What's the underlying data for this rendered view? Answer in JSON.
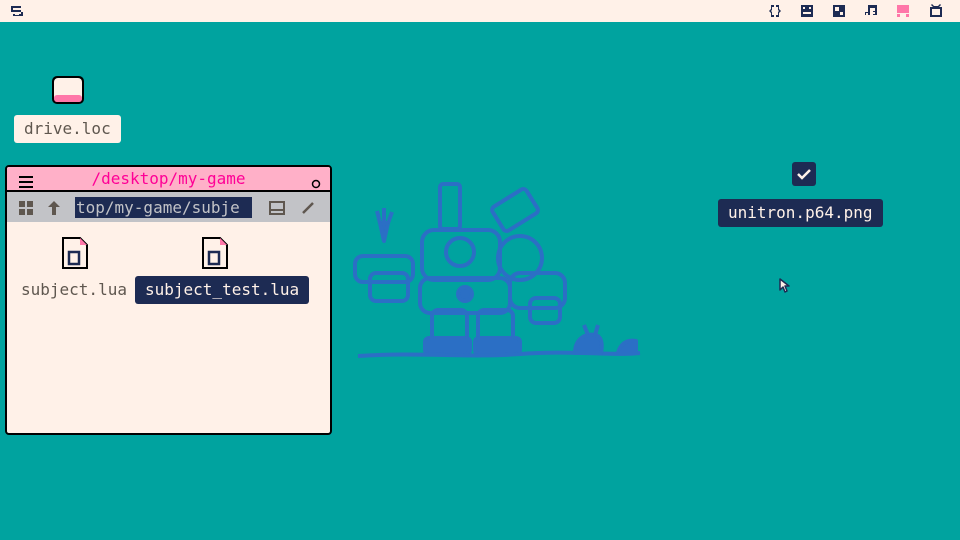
{
  "topbar": {
    "left_icon": "picotron-logo-icon",
    "right_icons": [
      "code-editor-icon",
      "sprite-editor-icon",
      "map-editor-icon",
      "sfx-editor-icon",
      "workspace-active-icon",
      "fullscreen-icon"
    ]
  },
  "desktop": {
    "drive": {
      "label": "drive.loc",
      "icon": "drive-icon"
    },
    "image_file": {
      "label": "unitron.p64.png",
      "icon": "image-checkbox-icon"
    },
    "wallpaper": "robot-and-bunnies-wallpaper"
  },
  "window": {
    "title": "/desktop/my-game",
    "path": "top/my-game/subje",
    "files": [
      {
        "name": "subject.lua",
        "selected": false
      },
      {
        "name": "subject_test.lua",
        "selected": true
      }
    ]
  },
  "colors": {
    "desktop_bg": "#00a39f",
    "topbar_bg": "#fff1e8",
    "title_bg": "#ffb0c8",
    "title_text": "#ff0096",
    "selection_bg": "#1d2b53",
    "wallpaper_ink": "#29adff"
  }
}
